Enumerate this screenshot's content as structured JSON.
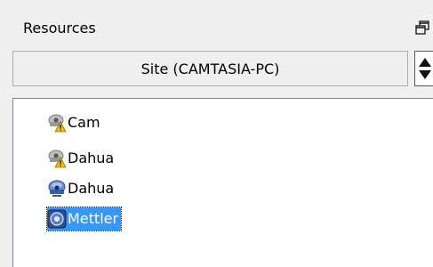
{
  "panel": {
    "title": "Resources",
    "icons": {
      "float": "restore-window-icon"
    }
  },
  "site_selector": {
    "value": "Site (CAMTASIA-PC)",
    "spin_icon": "up-down-spin-icon"
  },
  "tree": {
    "items": [
      {
        "label": "Cam",
        "icon": "camera-warning-icon",
        "selected": false
      },
      {
        "label": "Dahua",
        "icon": "camera-warning-icon",
        "selected": false
      },
      {
        "label": "Dahua",
        "icon": "camera-blue-icon",
        "selected": false
      },
      {
        "label": "Mettler",
        "icon": "device-blue-icon",
        "selected": true
      }
    ]
  },
  "colors": {
    "selection": "#3399ff",
    "warning": "#f5c400",
    "blue": "#2a5fb8"
  }
}
